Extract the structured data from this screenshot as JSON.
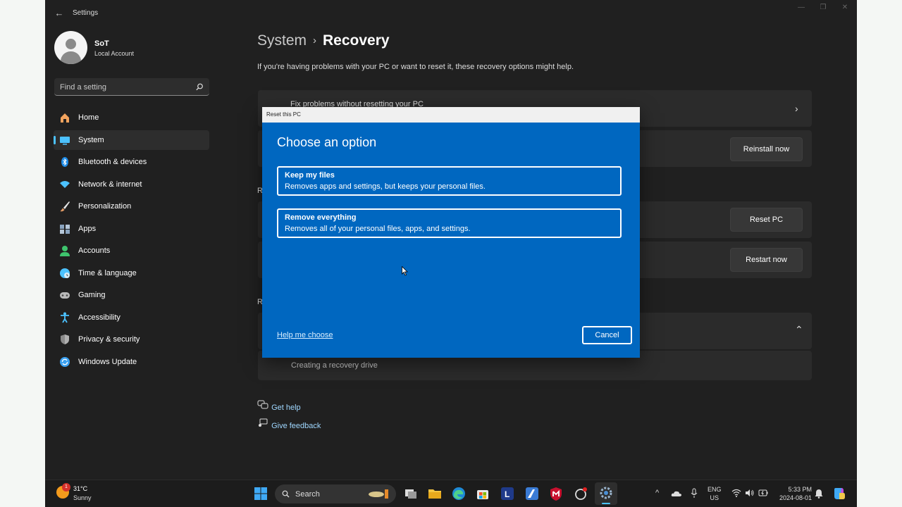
{
  "window": {
    "title": "Settings",
    "back": "←",
    "minimize": "—",
    "maximize": "❐",
    "close": "✕"
  },
  "profile": {
    "name": "SoT",
    "account_type": "Local Account"
  },
  "search": {
    "placeholder": "Find a setting"
  },
  "nav": [
    {
      "label": "Home",
      "icon": "home-icon",
      "color": "#f2a35e"
    },
    {
      "label": "System",
      "icon": "system-icon",
      "color": "#4cc2ff",
      "active": true
    },
    {
      "label": "Bluetooth & devices",
      "icon": "bluetooth-icon",
      "color": "#1c8ae6"
    },
    {
      "label": "Network & internet",
      "icon": "network-icon",
      "color": "#4cc2ff"
    },
    {
      "label": "Personalization",
      "icon": "brush-icon",
      "color": "#e29b66"
    },
    {
      "label": "Apps",
      "icon": "apps-icon",
      "color": "#8aa4c0"
    },
    {
      "label": "Accounts",
      "icon": "accounts-icon",
      "color": "#3ec46d"
    },
    {
      "label": "Time & language",
      "icon": "globe-clock-icon",
      "color": "#4cc2ff"
    },
    {
      "label": "Gaming",
      "icon": "gamepad-icon",
      "color": "#b8b8b8"
    },
    {
      "label": "Accessibility",
      "icon": "accessibility-icon",
      "color": "#4cc2ff"
    },
    {
      "label": "Privacy & security",
      "icon": "shield-icon",
      "color": "#8a8a8a"
    },
    {
      "label": "Windows Update",
      "icon": "update-icon",
      "color": "#3aa0f0"
    }
  ],
  "main": {
    "breadcrumb_parent": "System",
    "breadcrumb_sep": "›",
    "breadcrumb_current": "Recovery",
    "intro": "If you're having problems with your PC or want to reset it, these recovery options might help.",
    "fix_problems": "Fix problems without resetting your PC",
    "reinstall_button": "Reinstall now",
    "reset_button": "Reset PC",
    "restart_button": "Restart now",
    "section_letter_1": "R",
    "section_letter_2": "R",
    "recovery_drive": "Creating a recovery drive",
    "get_help": "Get help",
    "give_feedback": "Give feedback"
  },
  "dialog": {
    "title": "Reset this PC",
    "heading": "Choose an option",
    "options": [
      {
        "title": "Keep my files",
        "description": "Removes apps and settings, but keeps your personal files."
      },
      {
        "title": "Remove everything",
        "description": "Removes all of your personal files, apps, and settings."
      }
    ],
    "help_link": "Help me choose",
    "cancel": "Cancel"
  },
  "taskbar": {
    "weather_temp": "31°C",
    "weather_cond": "Sunny",
    "weather_badge": "1",
    "search_label": "Search",
    "lang_top": "ENG",
    "lang_bottom": "US",
    "time": "5:33 PM",
    "date": "2024-08-01",
    "tray_chevron": "^"
  }
}
